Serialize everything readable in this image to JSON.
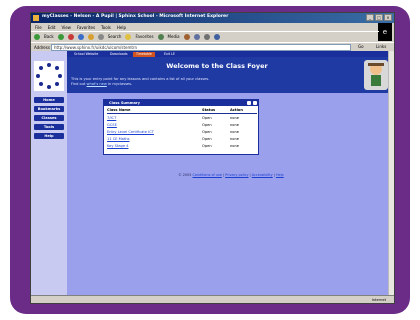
{
  "browser": {
    "title": "myClasses - Nelson - A Pupil | Sphinx School - Microsoft Internet Explorer",
    "menu": [
      "File",
      "Edit",
      "View",
      "Favorites",
      "Tools",
      "Help"
    ],
    "toolbar": [
      "Back",
      "Search",
      "Favorites",
      "Media"
    ],
    "address_label": "Address",
    "address_value": "http://www.sphinx.fr/uikdc/ulcom/stemtrn",
    "go_label": "Go",
    "links_label": "Links",
    "status_left": "",
    "status_right": "Internet"
  },
  "sidebar": {
    "buttons": [
      "Home",
      "Bookmarks",
      "Classes",
      "Tools",
      "Help"
    ]
  },
  "tabs": [
    "School Website",
    "Downloads",
    "Timetable",
    "Exit LE"
  ],
  "banner": {
    "heading": "Welcome to the Class Foyer",
    "line1": "This is your entry point for any lessons and contains a list of all your classes.",
    "line2_prefix": "Find out",
    "line2_link": "what's new",
    "line2_suffix": "in myclasses."
  },
  "panel": {
    "title": "Class Summary",
    "columns": [
      "Class Name",
      "Status",
      "Action"
    ],
    "rows": [
      {
        "name": "7/ICT",
        "status": "Open",
        "action": "none"
      },
      {
        "name": "GCSE",
        "status": "Open",
        "action": "none"
      },
      {
        "name": "Entry Level Certificate ICT",
        "status": "Open",
        "action": "none"
      },
      {
        "name": "11 CE Maths",
        "status": "Open",
        "action": "none"
      },
      {
        "name": "Key Stage 4",
        "status": "Open",
        "action": "none"
      }
    ]
  },
  "footer": {
    "prefix": "© 2005",
    "links": [
      "Conditions of use",
      "Privacy policy",
      "Accessibility",
      "Help"
    ]
  },
  "colors": {
    "frame": "#6a2c86",
    "page_bg": "#9aa0ec",
    "banner": "#1f3aa3",
    "nav": "#1b2f9c"
  }
}
